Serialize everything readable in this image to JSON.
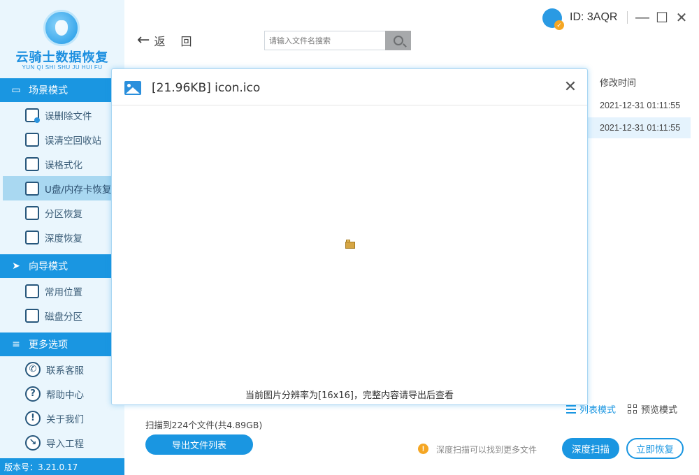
{
  "app": {
    "brand": "云骑士数据恢复",
    "pinyin": "YUN QI SHI SHU JU HUI FU",
    "user_id": "ID: 3AQR",
    "version": "版本号：3.21.0.17"
  },
  "window_controls": {
    "minimize": "—",
    "maximize": "☐",
    "close": "✕"
  },
  "sidebar": {
    "sections": [
      {
        "label": "场景模式",
        "items": [
          "误删除文件",
          "误清空回收站",
          "误格式化",
          "U盘/内存卡恢复",
          "分区恢复",
          "深度恢复"
        ]
      },
      {
        "label": "向导模式",
        "items": [
          "常用位置",
          "磁盘分区"
        ]
      },
      {
        "label": "更多选项",
        "items": [
          "联系客服",
          "帮助中心",
          "关于我们",
          "导入工程"
        ]
      }
    ],
    "active_item": "U盘/内存卡恢复"
  },
  "header": {
    "back_label": "返回",
    "search_placeholder": "请输入文件名搜索"
  },
  "table": {
    "column_modified": "修改时间",
    "rows": [
      "2021-12-31 01:11:55",
      "2021-12-31 01:11:55"
    ]
  },
  "preview_modal": {
    "title": "[21.96KB] icon.ico",
    "note": "当前图片分辨率为[16x16]，完整内容请导出后查看",
    "close": "✕"
  },
  "bottom": {
    "scan_summary": "扫描到224个文件(共4.89GB)",
    "export_button": "导出文件列表",
    "view_list": "列表模式",
    "view_grid": "预览模式",
    "tip": "深度扫描可以找到更多文件",
    "deep_scan_button": "深度扫描",
    "recover_button": "立即恢复"
  },
  "colors": {
    "accent": "#1a96e1",
    "sidebar_bg": "#eaf6fd",
    "active_item_bg": "#a9d8f1",
    "warning": "#f5a623"
  }
}
